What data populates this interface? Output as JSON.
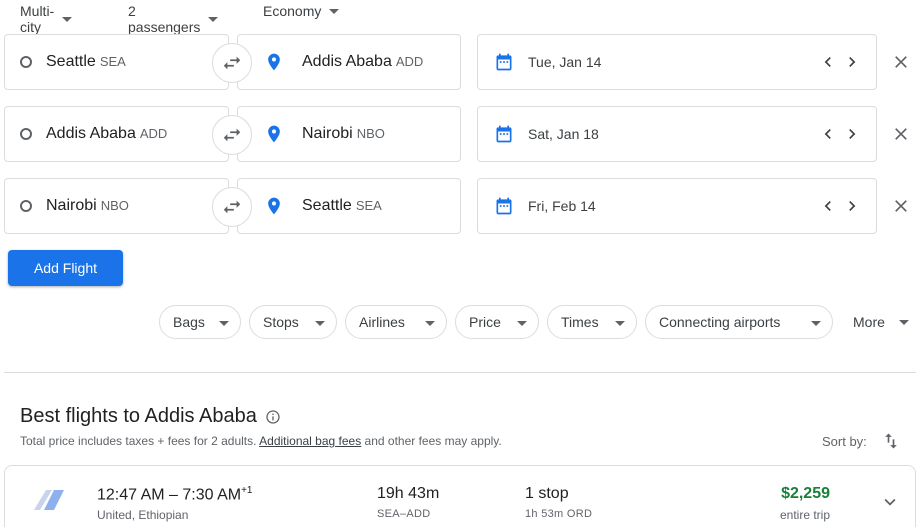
{
  "top": {
    "trip_type": "Multi-city",
    "passengers": "2 passengers",
    "cabin": "Economy"
  },
  "legs": [
    {
      "from_city": "Seattle",
      "from_code": "SEA",
      "to_city": "Addis Ababa",
      "to_code": "ADD",
      "date": "Tue, Jan 14"
    },
    {
      "from_city": "Addis Ababa",
      "from_code": "ADD",
      "to_city": "Nairobi",
      "to_code": "NBO",
      "date": "Sat, Jan 18"
    },
    {
      "from_city": "Nairobi",
      "from_code": "NBO",
      "to_city": "Seattle",
      "to_code": "SEA",
      "date": "Fri, Feb 14"
    }
  ],
  "add_flight_label": "Add Flight",
  "filters": [
    "Bags",
    "Stops",
    "Airlines",
    "Price",
    "Times",
    "Connecting airports"
  ],
  "more_label": "More",
  "results": {
    "title": "Best flights to Addis Ababa",
    "note_prefix": "Total price includes taxes + fees for 2 adults. ",
    "note_link": "Additional bag fees",
    "note_suffix": " and other fees may apply.",
    "sort_label": "Sort by:"
  },
  "flight": {
    "times": "12:47 AM – 7:30 AM",
    "day_offset": "+1",
    "airlines": "United, Ethiopian",
    "duration": "19h 43m",
    "route": "SEA–ADD",
    "stops": "1 stop",
    "layover": "1h 53m ORD",
    "price": "$2,259",
    "price_note": "entire trip"
  },
  "colors": {
    "accent": "#1a73e8",
    "price_green": "#188038",
    "border": "#dadce0"
  },
  "icons": {
    "origin": "ring-icon",
    "destination": "location-pin-icon",
    "swap": "swap-arrows-icon",
    "date": "calendar-icon",
    "remove": "close-icon",
    "info": "info-icon",
    "sort": "sort-arrows-icon",
    "expand": "chevron-down-icon"
  }
}
